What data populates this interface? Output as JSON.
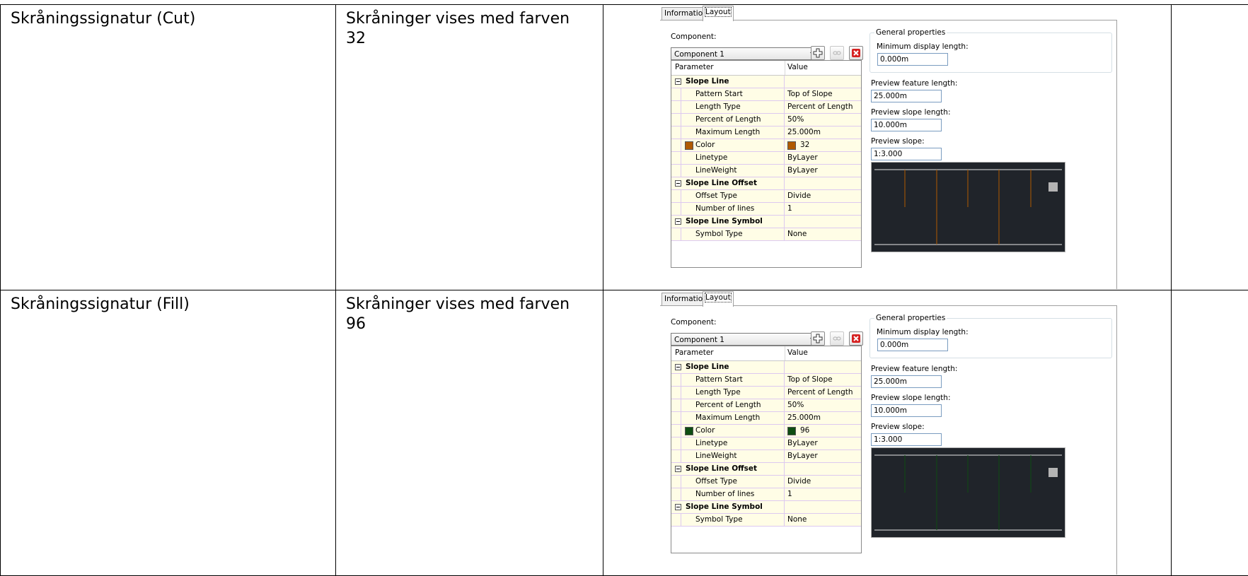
{
  "rows": [
    {
      "name": "Skråningssignatur (Cut)",
      "description": "Skråninger vises med farven 32",
      "dialog": {
        "tabs": [
          "Information",
          "Layout"
        ],
        "component_label": "Component:",
        "component_value": "Component 1",
        "grid_headers": {
          "parameter": "Parameter",
          "value": "Value"
        },
        "groups": [
          {
            "title": "Slope Line",
            "items": [
              {
                "param": "Pattern Start",
                "value": "Top of Slope"
              },
              {
                "param": "Length Type",
                "value": "Percent of Length"
              },
              {
                "param": "Percent of Length",
                "value": "50%"
              },
              {
                "param": "Maximum Length",
                "value": "25.000m"
              },
              {
                "param": "Color",
                "value": "32",
                "swatch": "#b05a00"
              },
              {
                "param": "Linetype",
                "value": "ByLayer"
              },
              {
                "param": "LineWeight",
                "value": "ByLayer"
              }
            ]
          },
          {
            "title": "Slope Line Offset",
            "items": [
              {
                "param": "Offset Type",
                "value": "Divide"
              },
              {
                "param": "Number of lines",
                "value": "1"
              }
            ]
          },
          {
            "title": "Slope Line Symbol",
            "items": [
              {
                "param": "Symbol Type",
                "value": "None"
              }
            ]
          }
        ],
        "general_properties": "General properties",
        "min_display_label": "Minimum display length:",
        "min_display_value": "0.000m",
        "preview_feature_label": "Preview feature length:",
        "preview_feature_value": "25.000m",
        "preview_slope_length_label": "Preview slope length:",
        "preview_slope_length_value": "10.000m",
        "preview_slope_label": "Preview slope:",
        "preview_slope_value": "1:3.000",
        "preview_line_color": "#b05a00"
      }
    },
    {
      "name": "Skråningssignatur (Fill)",
      "description": "Skråninger vises med farven 96",
      "dialog": {
        "tabs": [
          "Information",
          "Layout"
        ],
        "component_label": "Component:",
        "component_value": "Component 1",
        "grid_headers": {
          "parameter": "Parameter",
          "value": "Value"
        },
        "groups": [
          {
            "title": "Slope Line",
            "items": [
              {
                "param": "Pattern Start",
                "value": "Top of Slope"
              },
              {
                "param": "Length Type",
                "value": "Percent of Length"
              },
              {
                "param": "Percent of Length",
                "value": "50%"
              },
              {
                "param": "Maximum Length",
                "value": "25.000m"
              },
              {
                "param": "Color",
                "value": "96",
                "swatch": "#0e4d12"
              },
              {
                "param": "Linetype",
                "value": "ByLayer"
              },
              {
                "param": "LineWeight",
                "value": "ByLayer"
              }
            ]
          },
          {
            "title": "Slope Line Offset",
            "items": [
              {
                "param": "Offset Type",
                "value": "Divide"
              },
              {
                "param": "Number of lines",
                "value": "1"
              }
            ]
          },
          {
            "title": "Slope Line Symbol",
            "items": [
              {
                "param": "Symbol Type",
                "value": "None"
              }
            ]
          }
        ],
        "general_properties": "General properties",
        "min_display_label": "Minimum display length:",
        "min_display_value": "0.000m",
        "preview_feature_label": "Preview feature length:",
        "preview_feature_value": "25.000m",
        "preview_slope_length_label": "Preview slope length:",
        "preview_slope_length_value": "10.000m",
        "preview_slope_label": "Preview slope:",
        "preview_slope_value": "1:3.000",
        "preview_line_color": "#0e4d12"
      }
    }
  ]
}
